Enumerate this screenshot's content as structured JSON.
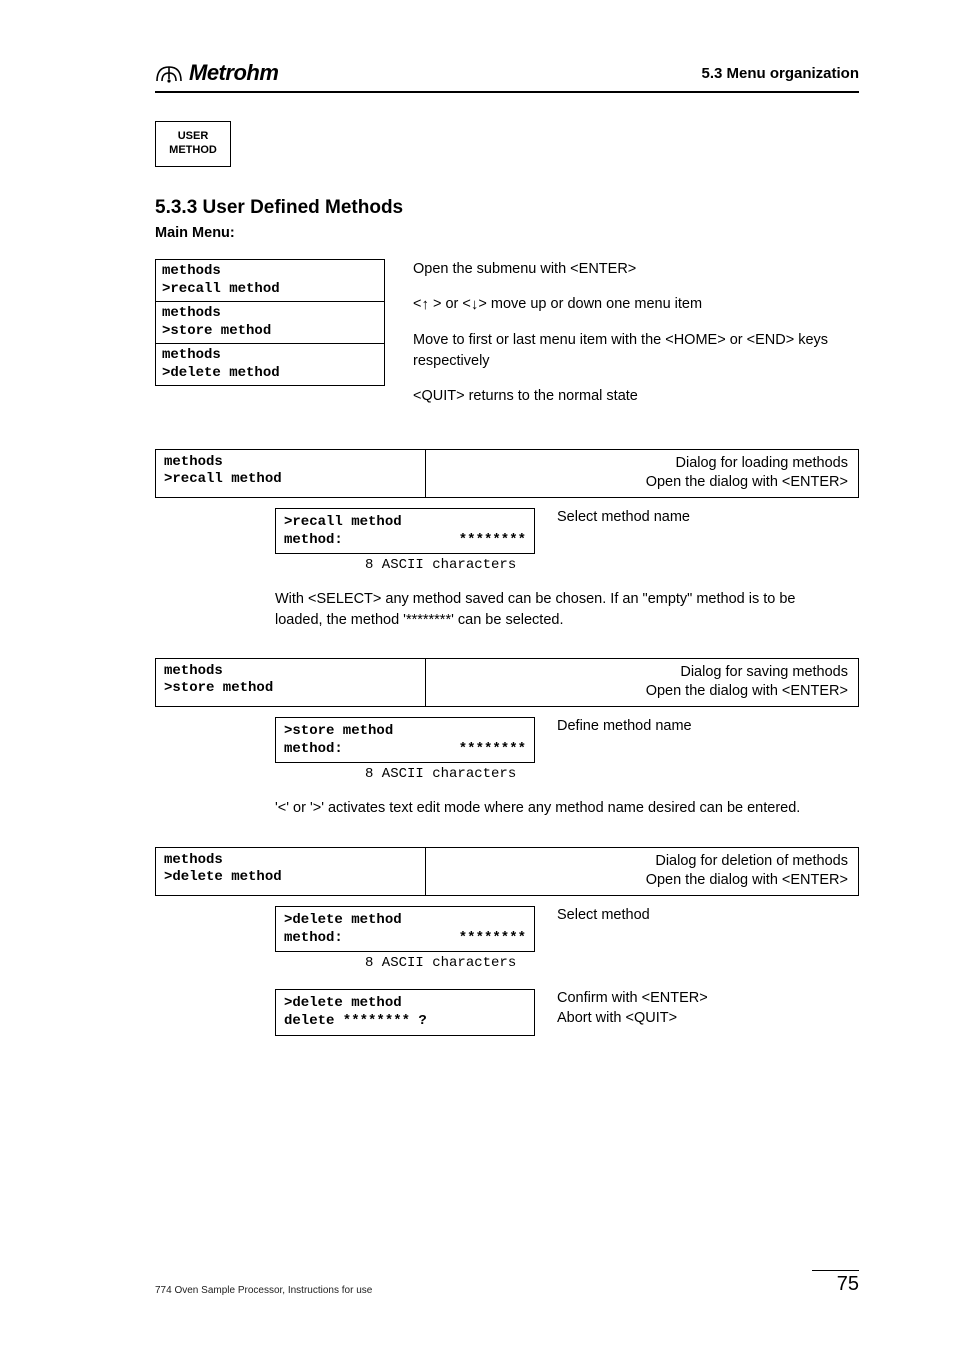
{
  "header": {
    "section_label": "5.3 Menu organization",
    "logo_name": "Metrohm"
  },
  "button": {
    "line1": "USER",
    "line2": "METHOD"
  },
  "section": {
    "number_title": "5.3.3  User Defined Methods",
    "main_menu_label": "Main Menu:"
  },
  "menu_stack": {
    "items": [
      {
        "l1": "methods",
        "l2": ">recall method"
      },
      {
        "l1": "methods",
        "l2": ">store method"
      },
      {
        "l1": "methods",
        "l2": ">delete method"
      }
    ]
  },
  "nav_instructions": {
    "p1": "Open the submenu with <ENTER>",
    "p2_pre": "<",
    "p2_mid": "> or <",
    "p2_post": "> move up or down one menu item",
    "p3": "Move to first or last menu item with the <HOME> or <END> keys respectively",
    "p4": "<QUIT> returns to the normal state"
  },
  "recall": {
    "menu_l1": "methods",
    "menu_l2": ">recall method",
    "right_l1": "Dialog for loading methods",
    "right_l2": "Open the dialog with <ENTER>",
    "code_l1": ">recall method",
    "code_l2a": "method:",
    "code_l2b": "********",
    "code_note": "8 ASCII characters",
    "desc": "Select method name",
    "para": "With <SELECT> any method saved can be chosen.  If an \"empty\" method is to be loaded, the method '********' can be selected."
  },
  "store": {
    "menu_l1": "methods",
    "menu_l2": ">store method",
    "right_l1": "Dialog for saving methods",
    "right_l2": "Open the dialog with <ENTER>",
    "code_l1": ">store method",
    "code_l2a": "method:",
    "code_l2b": "********",
    "code_note": "8 ASCII characters",
    "desc": "Define method name",
    "para": " '<' or '>' activates text edit mode where any method name desired can be entered."
  },
  "delete": {
    "menu_l1": "methods",
    "menu_l2": ">delete method",
    "right_l1": "Dialog for deletion of methods",
    "right_l2": "Open the dialog with <ENTER>",
    "code_l1": ">delete method",
    "code_l2a": "method:",
    "code_l2b": "********",
    "code_note": "8 ASCII characters",
    "desc": "Select method",
    "confirm_code_l1": ">delete method",
    "confirm_code_l2": "delete ******** ?",
    "confirm_desc_l1": "Confirm with <ENTER>",
    "confirm_desc_l2": "Abort with <QUIT>"
  },
  "footer": {
    "left": "774 Oven Sample Processor, Instructions for use",
    "page": "75"
  }
}
